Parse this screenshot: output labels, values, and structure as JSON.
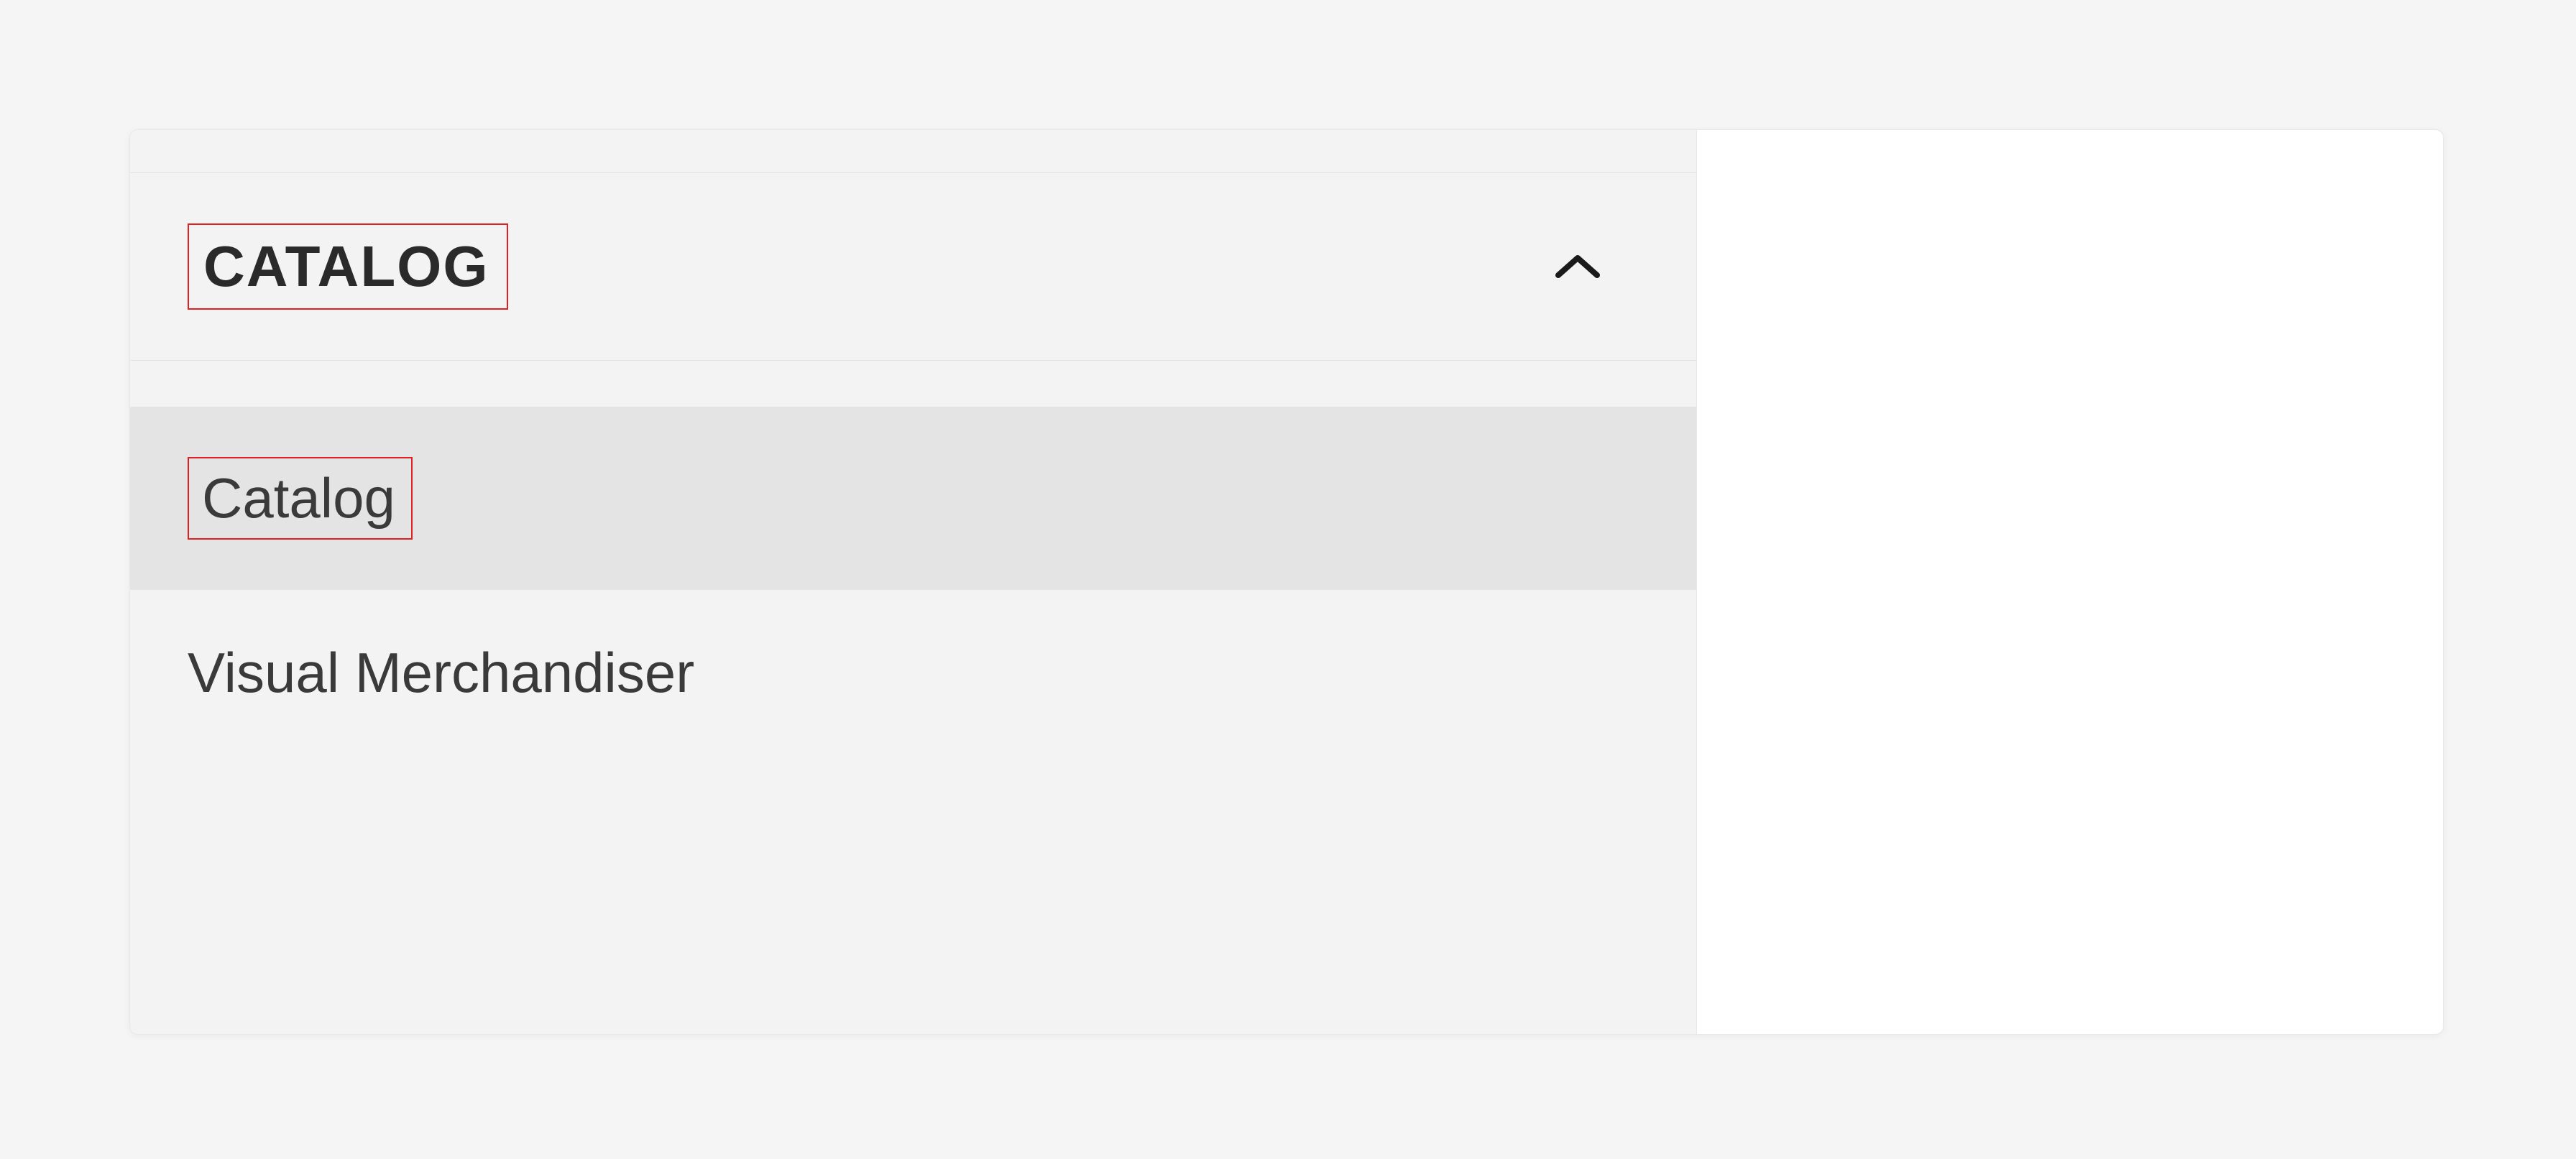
{
  "sidebar": {
    "section": {
      "title": "CATALOG",
      "expanded": true
    },
    "items": [
      {
        "label": "Catalog",
        "selected": true,
        "highlighted": true
      },
      {
        "label": "Visual Merchandiser",
        "selected": false,
        "highlighted": false
      }
    ]
  },
  "colors": {
    "highlight_border": "#e02020",
    "selected_bg": "#e4e4e4",
    "sidebar_bg": "#f3f3f3",
    "panel_bg": "#ffffff"
  }
}
